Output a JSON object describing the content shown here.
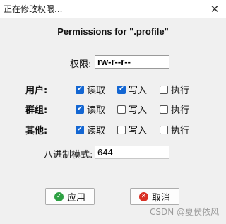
{
  "window": {
    "title": "正在修改权限...",
    "close_glyph": "✕"
  },
  "heading": "Permissions for \".profile\"",
  "permissions": {
    "label": "权限:",
    "value": "rw-r--r--"
  },
  "rows": [
    {
      "label": "用户:",
      "read": {
        "label": "读取",
        "checked": true
      },
      "write": {
        "label": "写入",
        "checked": true
      },
      "exec": {
        "label": "执行",
        "checked": false
      }
    },
    {
      "label": "群组:",
      "read": {
        "label": "读取",
        "checked": true
      },
      "write": {
        "label": "写入",
        "checked": false
      },
      "exec": {
        "label": "执行",
        "checked": false
      }
    },
    {
      "label": "其他:",
      "read": {
        "label": "读取",
        "checked": true
      },
      "write": {
        "label": "写入",
        "checked": false
      },
      "exec": {
        "label": "执行",
        "checked": false
      }
    }
  ],
  "octal": {
    "label": "八进制模式:",
    "value": "644"
  },
  "buttons": {
    "apply": {
      "label": "应用",
      "icon": "check-circle-icon",
      "color": "#2ea043"
    },
    "cancel": {
      "label": "取消",
      "icon": "x-circle-icon",
      "color": "#d93025"
    }
  },
  "watermark": "CSDN @夏侯依风",
  "colors": {
    "checkbox_checked": "#1366d2"
  }
}
